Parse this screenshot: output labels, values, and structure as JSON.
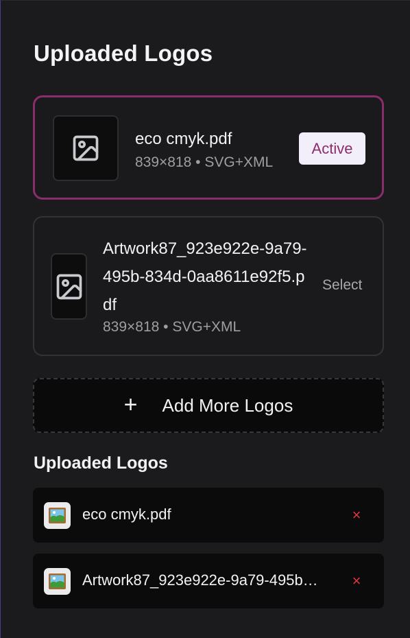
{
  "header": {
    "title": "Uploaded Logos"
  },
  "logo_cards": [
    {
      "filename": "eco cmyk.pdf",
      "meta": "839×818 • SVG+XML",
      "status": "Active",
      "icon": "image-icon"
    },
    {
      "filename": "Artwork87_923e922e-9a79-495b-834d-0aa8611e92f5.pdf",
      "meta": "839×818 • SVG+XML",
      "action": "Select",
      "icon": "image-icon"
    }
  ],
  "add_button": {
    "icon": "plus-icon",
    "label": "Add More Logos"
  },
  "uploaded_list": {
    "title": "Uploaded Logos",
    "items": [
      {
        "filename": "eco cmyk.pdf",
        "remove_label": "×",
        "icon": "picture-icon"
      },
      {
        "filename": "Artwork87_923e922e-9a79-495b…",
        "remove_label": "×",
        "icon": "picture-icon"
      }
    ]
  },
  "colors": {
    "background": "#1b1b1d",
    "accent": "#8a2d6c",
    "badge_bg": "#f3effa",
    "danger": "#e0363b"
  }
}
